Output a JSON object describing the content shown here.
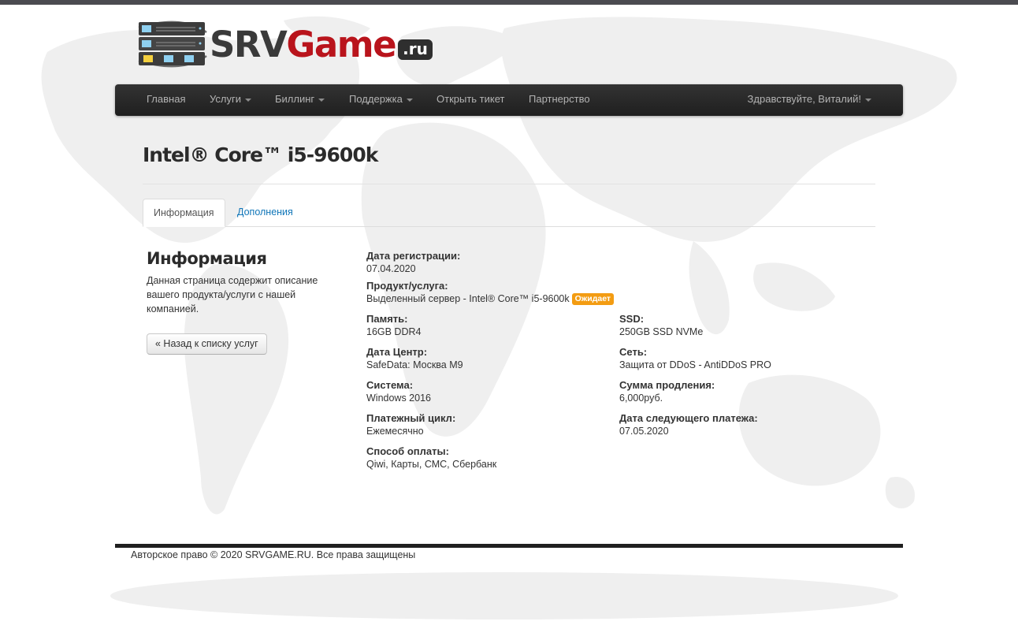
{
  "brand": {
    "name_srv": "SRV",
    "name_game": "Game",
    "name_tld": ".ru",
    "color_dark": "#3a3a3a",
    "color_red": "#b9141c"
  },
  "nav": {
    "items": [
      {
        "label": "Главная",
        "dropdown": false
      },
      {
        "label": "Услуги",
        "dropdown": true
      },
      {
        "label": "Биллинг",
        "dropdown": true
      },
      {
        "label": "Поддержка",
        "dropdown": true
      },
      {
        "label": "Открыть тикет",
        "dropdown": false
      },
      {
        "label": "Партнерство",
        "dropdown": false
      }
    ],
    "user_greeting": "Здравствуйте, Виталий!"
  },
  "page_title": "Intel® Core™ i5-9600k",
  "tabs": [
    {
      "label": "Информация",
      "active": true
    },
    {
      "label": "Дополнения",
      "active": false
    }
  ],
  "sidebar": {
    "title": "Информация",
    "description": "Данная страница содержит описание вашего продукта/услуги с нашей компанией.",
    "back_button": "« Назад к списку услуг"
  },
  "details": {
    "registration": {
      "label": "Дата регистрации:",
      "value": "07.04.2020"
    },
    "product": {
      "label": "Продукт/услуга:",
      "value": "Выделенный сервер - Intel® Core™ i5-9600k",
      "status": "Ожидает",
      "status_color": "#f39c12"
    },
    "memory": {
      "label": "Память:",
      "value": "16GB DDR4"
    },
    "ssd": {
      "label": "SSD:",
      "value": "250GB SSD NVMe"
    },
    "datacenter": {
      "label": "Дата Центр:",
      "value": "SafeData: Москва M9"
    },
    "network": {
      "label": "Сеть:",
      "value": "Защита от DDoS - AntiDDoS PRO"
    },
    "os": {
      "label": "Система:",
      "value": "Windows 2016"
    },
    "renewal_amount": {
      "label": "Сумма продления:",
      "value": "6,000руб."
    },
    "billing_cycle": {
      "label": "Платежный цикл:",
      "value": "Ежемесячно"
    },
    "next_due": {
      "label": "Дата следующего платежа:",
      "value": "07.05.2020"
    },
    "payment_method": {
      "label": "Способ оплаты:",
      "value": "Qiwi, Карты, СМС, Сбербанк"
    }
  },
  "footer": {
    "copyright": "Авторское право © 2020 SRVGAME.RU. Все права защищены"
  }
}
